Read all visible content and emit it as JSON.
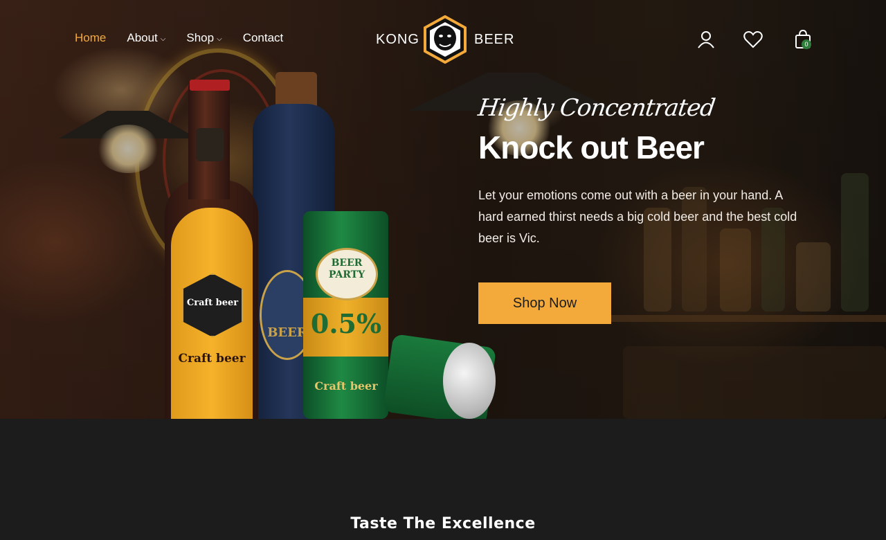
{
  "nav": {
    "items": [
      {
        "label": "Home",
        "active": true,
        "dropdown": false
      },
      {
        "label": "About",
        "active": false,
        "dropdown": true
      },
      {
        "label": "Shop",
        "active": false,
        "dropdown": true
      },
      {
        "label": "Contact",
        "active": false,
        "dropdown": false
      }
    ]
  },
  "logo": {
    "left": "KONG",
    "right": "BEER"
  },
  "header_icons": {
    "account": "user-icon",
    "wishlist": "heart-icon",
    "cart": "shopping-bag-icon",
    "cart_count": "0"
  },
  "hero": {
    "tagline": "Highly Concentrated",
    "title": "Knock out Beer",
    "description": "Let your emotions come out with a beer in your hand. A hard earned thirst needs a big cold beer and the best cold beer is Vic.",
    "cta_label": "Shop Now",
    "product_labels": {
      "bottle_label": "Craft beer",
      "can_top": "BEER PARTY",
      "can_abv": "0.5%",
      "can_bottom": "Craft beer",
      "blue_bottle": "BEER"
    }
  },
  "section": {
    "title": "Taste The Excellence"
  },
  "colors": {
    "accent": "#f4aa3b",
    "dark_bg": "#1c1c1c",
    "badge_green": "#2f7d3a"
  }
}
